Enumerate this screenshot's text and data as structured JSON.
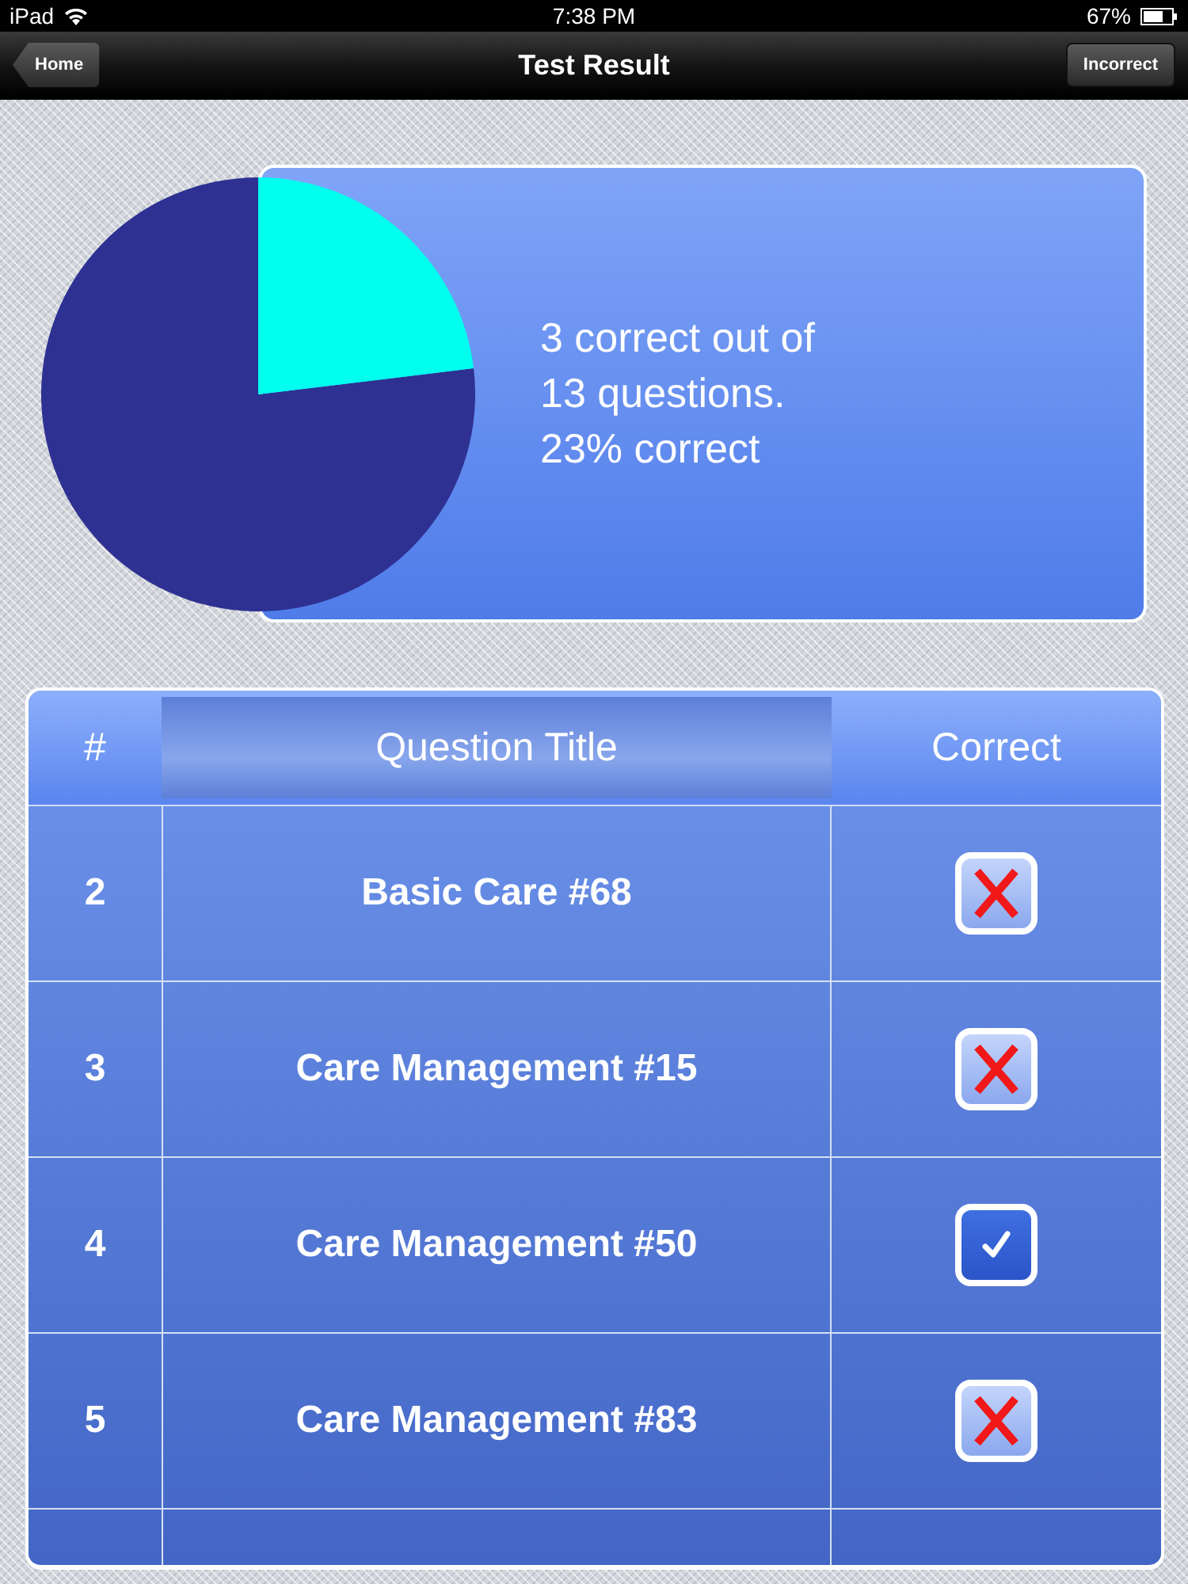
{
  "status_bar": {
    "device": "iPad",
    "time": "7:38 PM",
    "battery": "67%"
  },
  "nav_bar": {
    "back_button": "Home",
    "title": "Test Result",
    "right_button": "Incorrect"
  },
  "summary": {
    "lines": [
      "3 correct out of",
      "13 questions.",
      "23% correct"
    ]
  },
  "table": {
    "columns": [
      "#",
      "Question Title",
      "Correct"
    ],
    "rows": [
      {
        "number": "2",
        "title": "Basic Care #68",
        "correct": false
      },
      {
        "number": "3",
        "title": "Care Management #15",
        "correct": false
      },
      {
        "number": "4",
        "title": "Care Management #50",
        "correct": true
      },
      {
        "number": "5",
        "title": "Care Management #83",
        "correct": false
      }
    ]
  }
}
